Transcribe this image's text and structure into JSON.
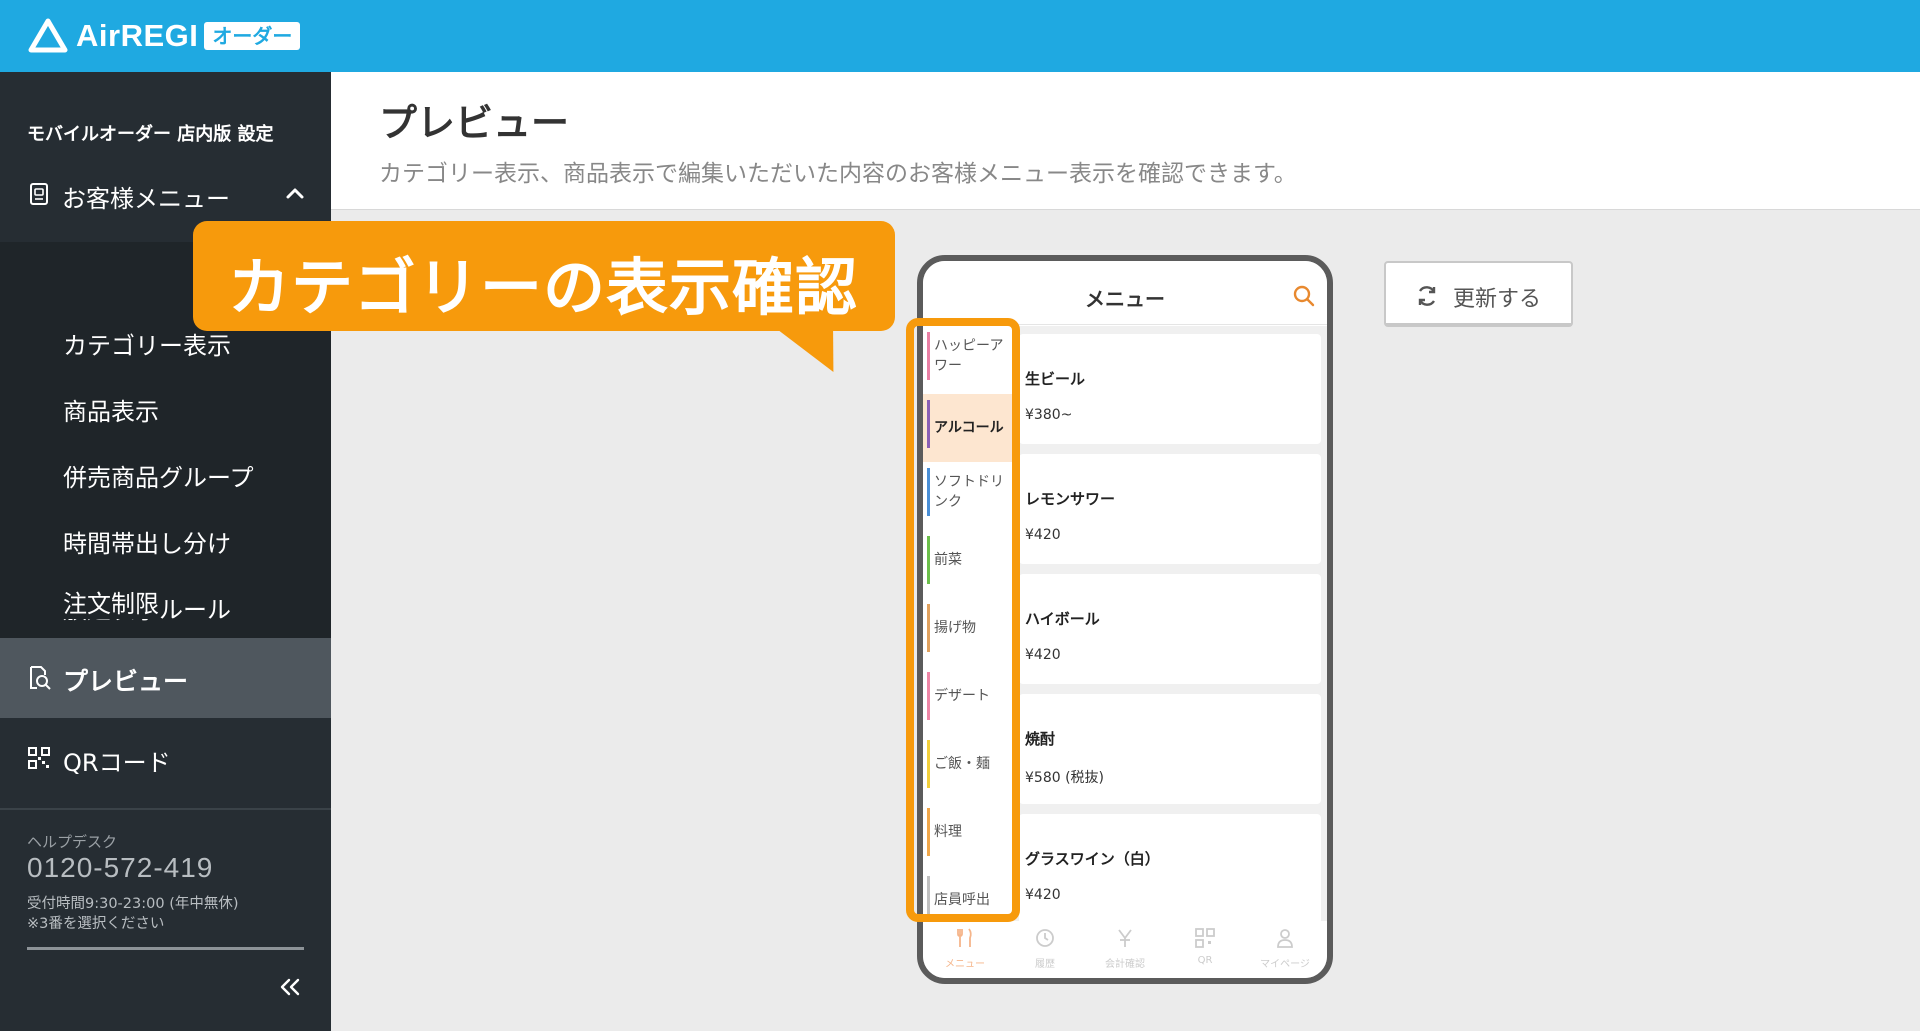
{
  "brand": {
    "name": "AirREGI",
    "badge": "オーダー"
  },
  "sidebar": {
    "title": "モバイルオーダー 店内版 設定",
    "group_label": "お客様メニュー",
    "sub_items": [
      "カテゴリー表示",
      "商品表示",
      "併売商品グループ",
      "時間帯出し分け",
      "放題表示ルール",
      "注文制限"
    ],
    "preview_label": "プレビュー",
    "qr_label": "QRコード",
    "help": {
      "title": "ヘルプデスク",
      "phone": "0120-572-419",
      "hours": "受付時間9:30-23:00 (年中無休)",
      "note": "※3番を選択ください"
    }
  },
  "main": {
    "title": "プレビュー",
    "description": "カテゴリー表示、商品表示で編集いただいた内容のお客様メニュー表示を確認できます。",
    "refresh_label": "更新する"
  },
  "callout": {
    "text": "カテゴリーの表示確認"
  },
  "phone": {
    "title": "メニュー",
    "categories": [
      {
        "label": "ハッピーアワー",
        "color": "#e97fa4"
      },
      {
        "label": "アルコール",
        "color": "#8b5fb5",
        "active": true
      },
      {
        "label": "ソフトドリンク",
        "color": "#4a8fd6"
      },
      {
        "label": "前菜",
        "color": "#6cbf4b"
      },
      {
        "label": "揚げ物",
        "color": "#e0a15e"
      },
      {
        "label": "デザート",
        "color": "#ee86a6"
      },
      {
        "label": "ご飯・麺",
        "color": "#f2cf3b"
      },
      {
        "label": "料理",
        "color": "#f0a74a"
      },
      {
        "label": "店員呼出",
        "color": "#c0c0c0"
      }
    ],
    "items": [
      {
        "name": "生ビール",
        "price": "¥380~"
      },
      {
        "name": "レモンサワー",
        "price": "¥420"
      },
      {
        "name": "ハイボール",
        "price": "¥420"
      },
      {
        "name": "焼酎",
        "price": "¥580 (税抜)"
      },
      {
        "name": "グラスワイン（白）",
        "price": "¥420"
      }
    ],
    "tabs": [
      {
        "label": "メニュー",
        "icon": "fork-knife-icon",
        "active": true
      },
      {
        "label": "履歴",
        "icon": "history-icon"
      },
      {
        "label": "会計確認",
        "icon": "yen-icon"
      },
      {
        "label": "QR",
        "icon": "qr-icon"
      },
      {
        "label": "マイページ",
        "icon": "person-icon"
      }
    ]
  },
  "colors": {
    "header": "#1fa9e1",
    "sidebar": "#262d33",
    "accent": "#f79a0c"
  }
}
